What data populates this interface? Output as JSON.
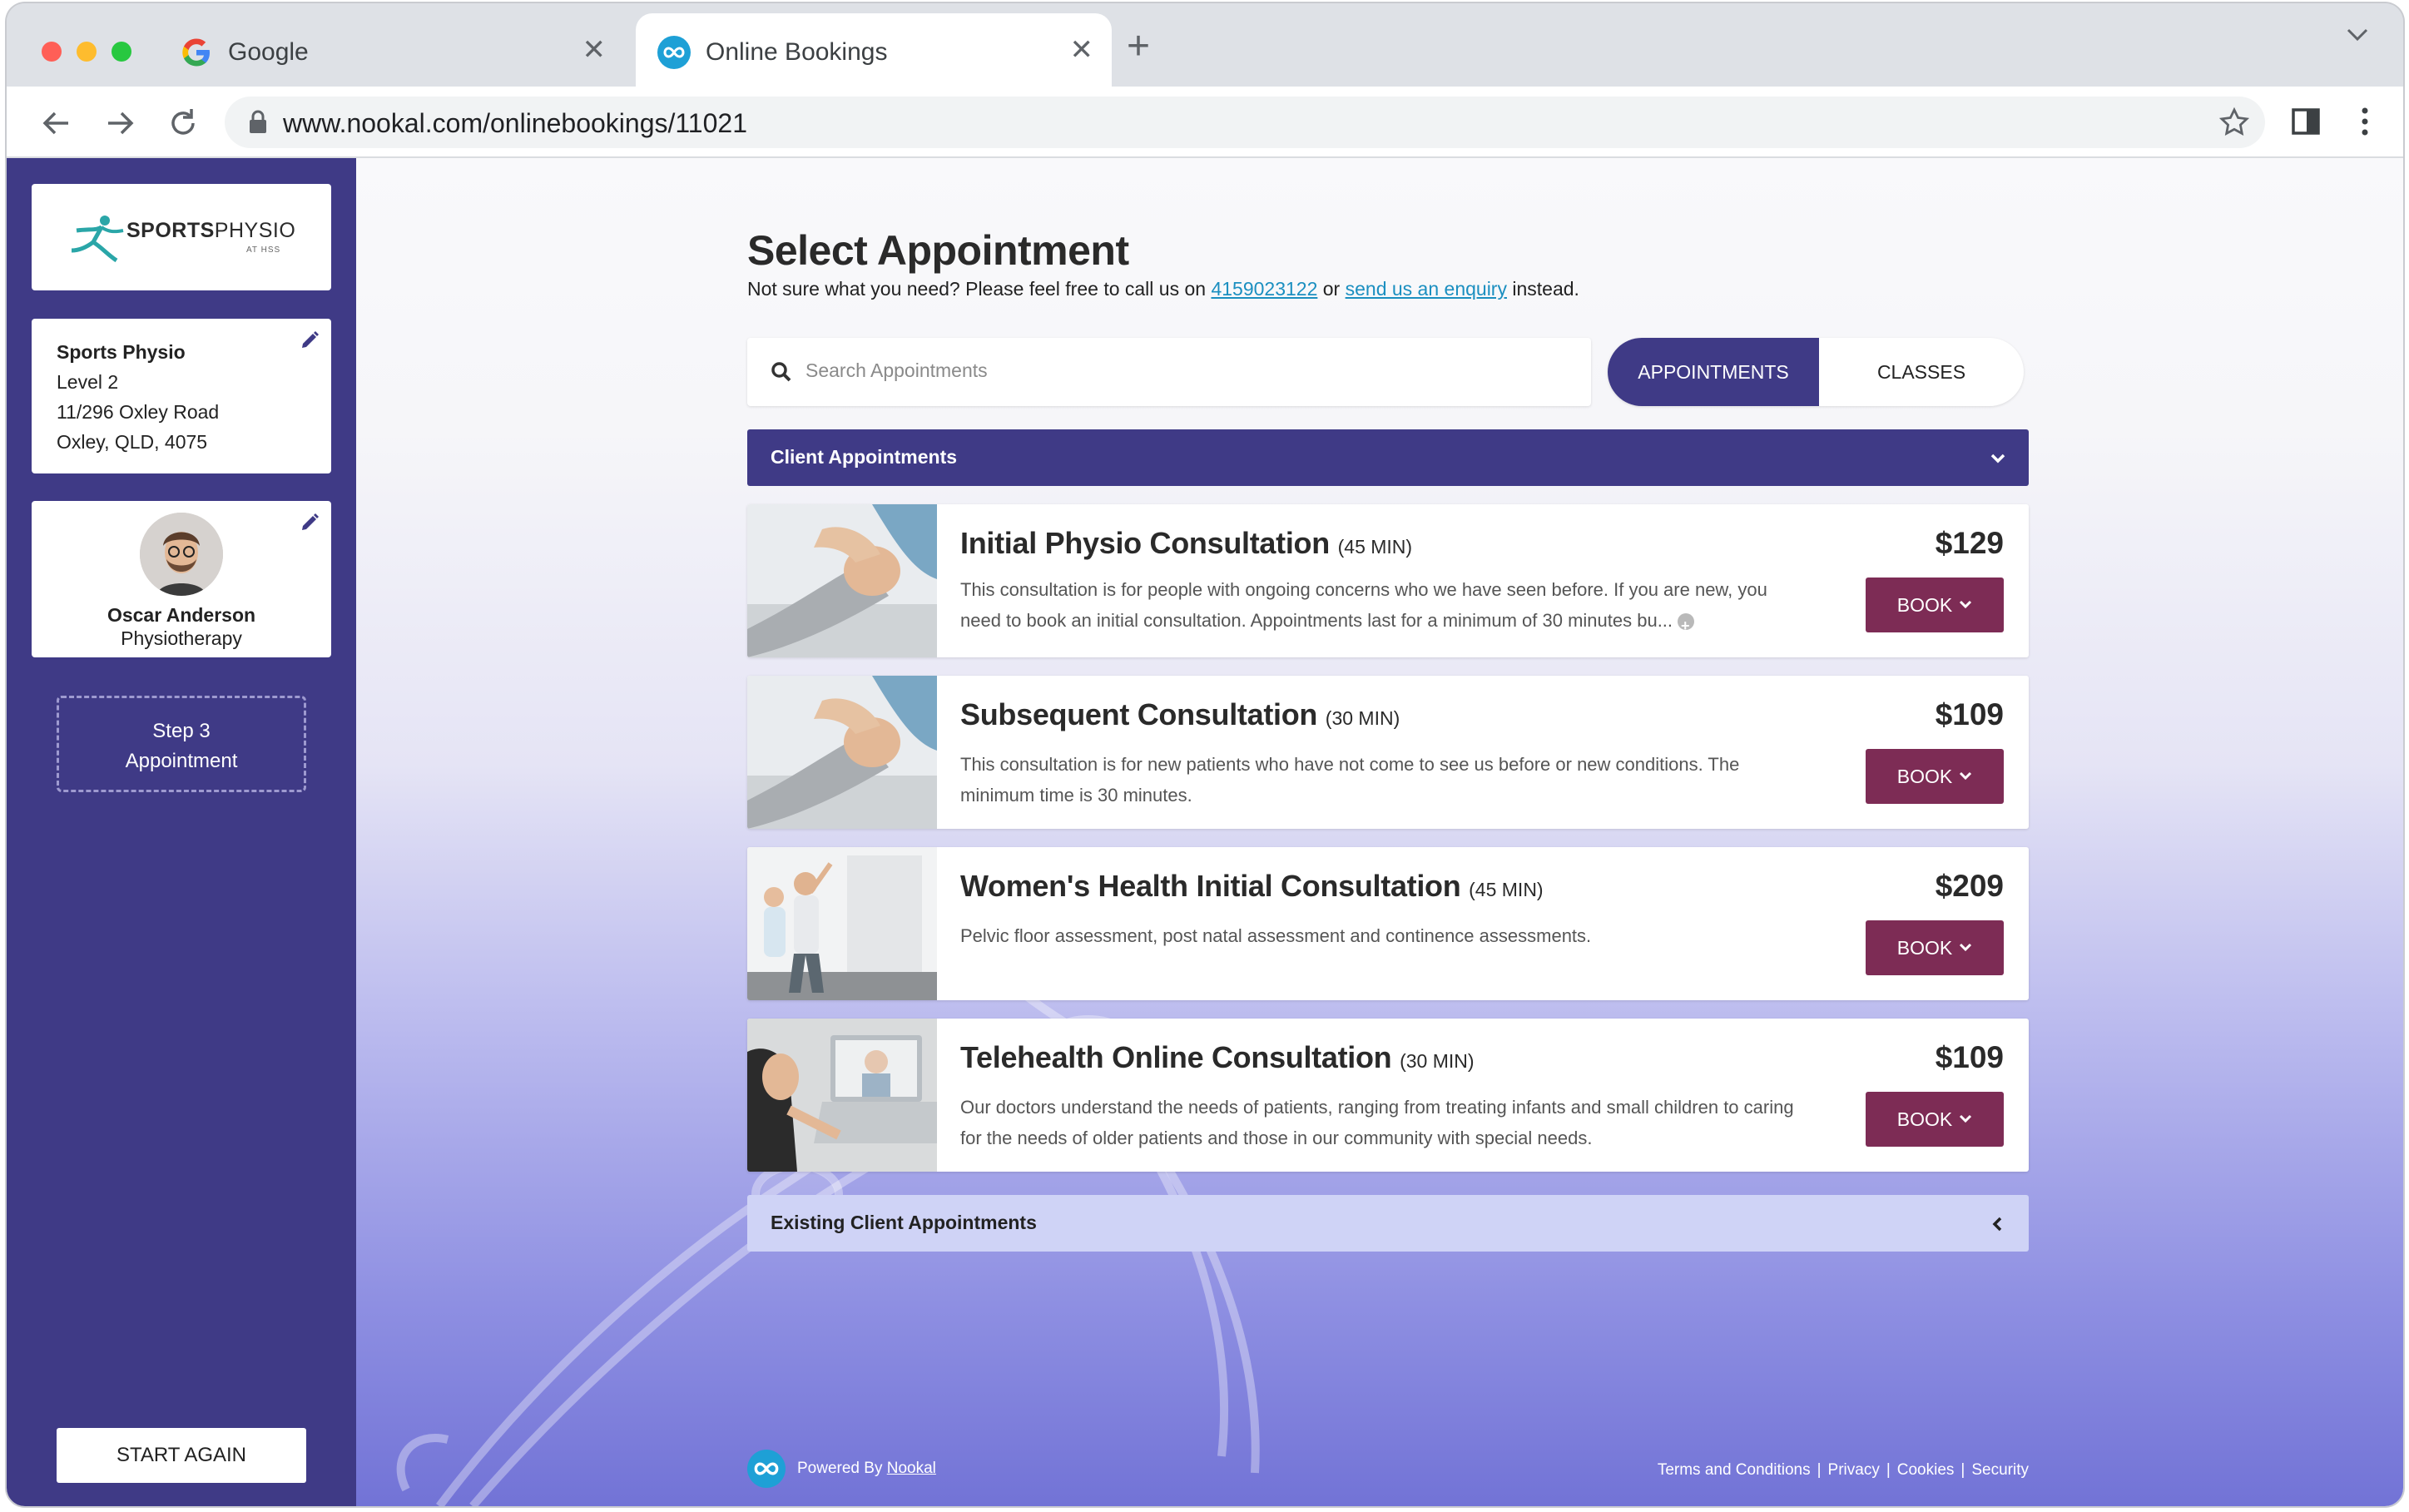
{
  "browser": {
    "tabs": [
      {
        "title": "Google",
        "icon": "google-icon",
        "active": false
      },
      {
        "title": "Online Bookings",
        "icon": "nookal-icon",
        "active": true
      }
    ],
    "url": "www.nookal.com/onlinebookings/11021"
  },
  "sidebar": {
    "logo": {
      "brand_bold": "SPORTS",
      "brand_light": "PHYSIO",
      "sub": "AT HSS"
    },
    "location": {
      "name": "Sports Physio",
      "lines": [
        "Level 2",
        "11/296 Oxley Road",
        "Oxley, QLD, 4075"
      ]
    },
    "practitioner": {
      "name": "Oscar Anderson",
      "role": "Physiotherapy"
    },
    "step": {
      "label": "Step 3",
      "name": "Appointment"
    },
    "start_again": "START AGAIN"
  },
  "main": {
    "title": "Select Appointment",
    "intro": {
      "before": "Not sure what you need? Please feel free to call us on ",
      "phone": "4159023122",
      "middle": " or ",
      "enquiry": "send us an enquiry",
      "after": " instead."
    },
    "search_placeholder": "Search Appointments",
    "toggle": {
      "appointments": "APPOINTMENTS",
      "classes": "CLASSES"
    },
    "client_section": "Client Appointments",
    "existing_section": "Existing Client Appointments",
    "book_label": "BOOK",
    "appointments": [
      {
        "title": "Initial Physio Consultation",
        "duration": "(45 MIN)",
        "price": "$129",
        "description": "This consultation is for people with ongoing concerns who we have seen before. If you are new, you need to book an initial consultation. Appointments last for a minimum of 30 minutes bu..."
      },
      {
        "title": "Subsequent Consultation",
        "duration": "(30 MIN)",
        "price": "$109",
        "description": "This consultation is for new patients who have not come to see us before or new conditions. The minimum time is 30 minutes."
      },
      {
        "title": "Women's Health Initial Consultation",
        "duration": "(45 MIN)",
        "price": "$209",
        "description": "Pelvic floor assessment, post natal assessment and continence assessments."
      },
      {
        "title": "Telehealth Online Consultation",
        "duration": "(30 MIN)",
        "price": "$109",
        "description": "Our doctors understand the needs of patients, ranging from treating infants and small children to caring for the needs of older patients and those in our community with special needs."
      }
    ],
    "footer": {
      "powered_by": "Powered By",
      "brand": "Nookal",
      "links": [
        "Terms and Conditions",
        "Privacy",
        "Cookies",
        "Security"
      ]
    }
  },
  "colors": {
    "sidebar": "#3f3a86",
    "book_button": "#7d2c55",
    "link": "#1b8fc0",
    "existing_bar": "#cfd3f6"
  }
}
